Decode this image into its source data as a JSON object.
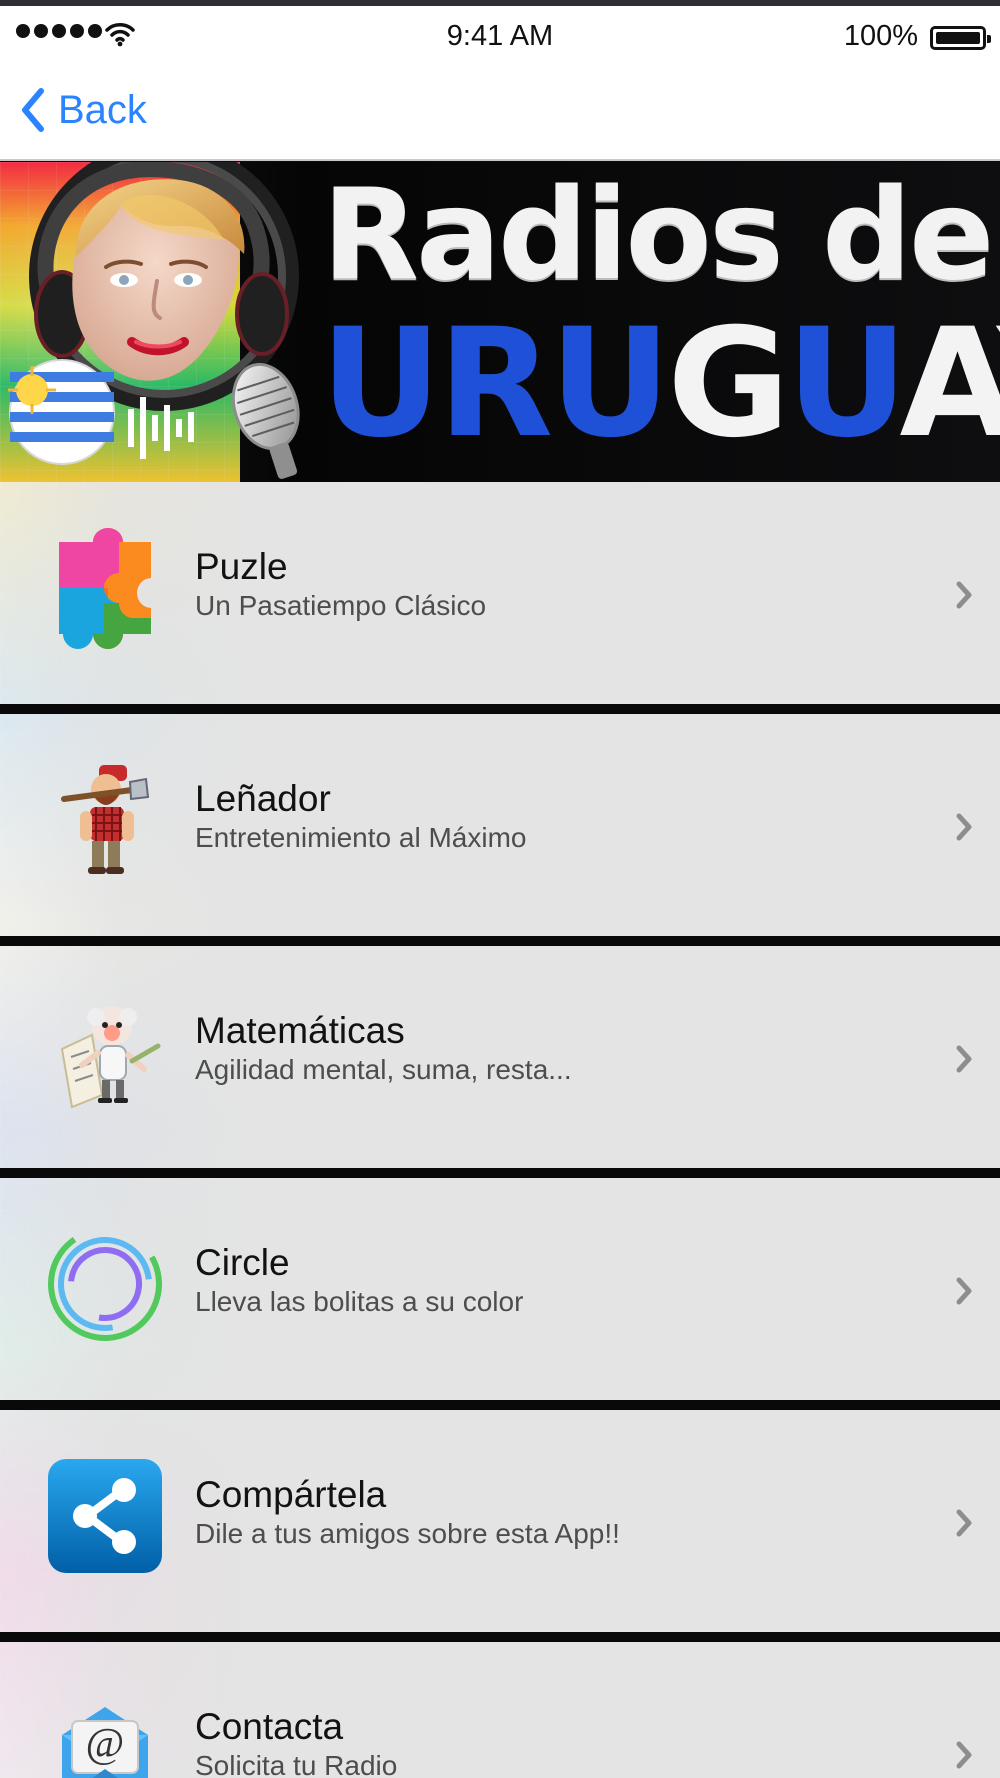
{
  "statusbar": {
    "time": "9:41 AM",
    "battery": "100%"
  },
  "navbar": {
    "back_label": "Back"
  },
  "banner": {
    "line1": "Radios de",
    "line2_part1": "UR",
    "line2_part2": "U",
    "line2_part3": "G",
    "line2_part4": "U",
    "line2_part5": "AY"
  },
  "menu": {
    "items": [
      {
        "title": "Puzle",
        "subtitle": "Un Pasatiempo Clásico",
        "icon": "puzzle-icon"
      },
      {
        "title": "Leñador",
        "subtitle": "Entretenimiento al Máximo",
        "icon": "lumberjack-icon"
      },
      {
        "title": "Matemáticas",
        "subtitle": "Agilidad mental, suma, resta...",
        "icon": "math-icon"
      },
      {
        "title": "Circle",
        "subtitle": "Lleva las bolitas a su color",
        "icon": "circle-icon"
      },
      {
        "title": "Compártela",
        "subtitle": "Dile a tus amigos sobre esta App!!",
        "icon": "share-icon"
      },
      {
        "title": "Contacta",
        "subtitle": "Solicita tu Radio",
        "icon": "mail-icon"
      }
    ]
  }
}
